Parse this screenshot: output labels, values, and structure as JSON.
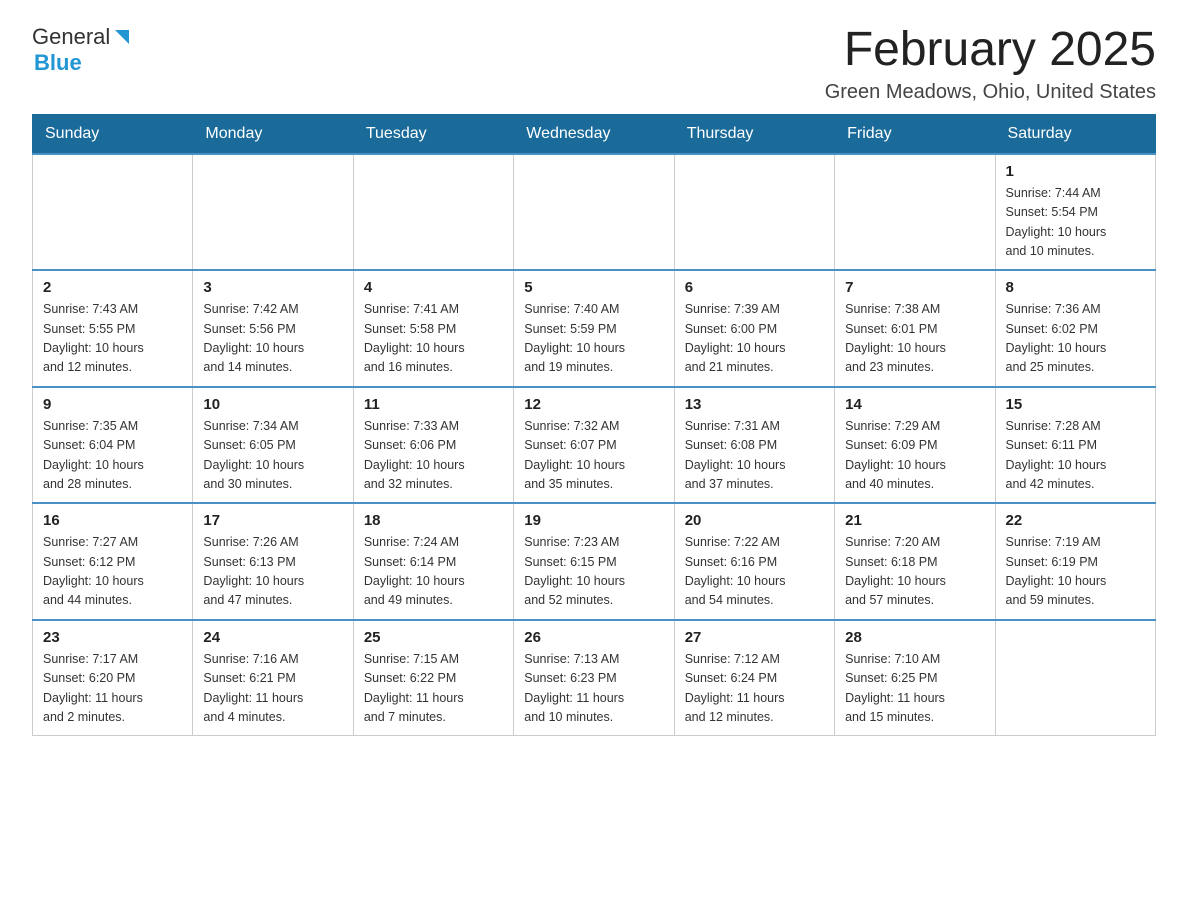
{
  "header": {
    "logo_general": "General",
    "logo_blue": "Blue",
    "title": "February 2025",
    "subtitle": "Green Meadows, Ohio, United States"
  },
  "days_of_week": [
    "Sunday",
    "Monday",
    "Tuesday",
    "Wednesday",
    "Thursday",
    "Friday",
    "Saturday"
  ],
  "weeks": [
    [
      {
        "day": "",
        "info": ""
      },
      {
        "day": "",
        "info": ""
      },
      {
        "day": "",
        "info": ""
      },
      {
        "day": "",
        "info": ""
      },
      {
        "day": "",
        "info": ""
      },
      {
        "day": "",
        "info": ""
      },
      {
        "day": "1",
        "info": "Sunrise: 7:44 AM\nSunset: 5:54 PM\nDaylight: 10 hours\nand 10 minutes."
      }
    ],
    [
      {
        "day": "2",
        "info": "Sunrise: 7:43 AM\nSunset: 5:55 PM\nDaylight: 10 hours\nand 12 minutes."
      },
      {
        "day": "3",
        "info": "Sunrise: 7:42 AM\nSunset: 5:56 PM\nDaylight: 10 hours\nand 14 minutes."
      },
      {
        "day": "4",
        "info": "Sunrise: 7:41 AM\nSunset: 5:58 PM\nDaylight: 10 hours\nand 16 minutes."
      },
      {
        "day": "5",
        "info": "Sunrise: 7:40 AM\nSunset: 5:59 PM\nDaylight: 10 hours\nand 19 minutes."
      },
      {
        "day": "6",
        "info": "Sunrise: 7:39 AM\nSunset: 6:00 PM\nDaylight: 10 hours\nand 21 minutes."
      },
      {
        "day": "7",
        "info": "Sunrise: 7:38 AM\nSunset: 6:01 PM\nDaylight: 10 hours\nand 23 minutes."
      },
      {
        "day": "8",
        "info": "Sunrise: 7:36 AM\nSunset: 6:02 PM\nDaylight: 10 hours\nand 25 minutes."
      }
    ],
    [
      {
        "day": "9",
        "info": "Sunrise: 7:35 AM\nSunset: 6:04 PM\nDaylight: 10 hours\nand 28 minutes."
      },
      {
        "day": "10",
        "info": "Sunrise: 7:34 AM\nSunset: 6:05 PM\nDaylight: 10 hours\nand 30 minutes."
      },
      {
        "day": "11",
        "info": "Sunrise: 7:33 AM\nSunset: 6:06 PM\nDaylight: 10 hours\nand 32 minutes."
      },
      {
        "day": "12",
        "info": "Sunrise: 7:32 AM\nSunset: 6:07 PM\nDaylight: 10 hours\nand 35 minutes."
      },
      {
        "day": "13",
        "info": "Sunrise: 7:31 AM\nSunset: 6:08 PM\nDaylight: 10 hours\nand 37 minutes."
      },
      {
        "day": "14",
        "info": "Sunrise: 7:29 AM\nSunset: 6:09 PM\nDaylight: 10 hours\nand 40 minutes."
      },
      {
        "day": "15",
        "info": "Sunrise: 7:28 AM\nSunset: 6:11 PM\nDaylight: 10 hours\nand 42 minutes."
      }
    ],
    [
      {
        "day": "16",
        "info": "Sunrise: 7:27 AM\nSunset: 6:12 PM\nDaylight: 10 hours\nand 44 minutes."
      },
      {
        "day": "17",
        "info": "Sunrise: 7:26 AM\nSunset: 6:13 PM\nDaylight: 10 hours\nand 47 minutes."
      },
      {
        "day": "18",
        "info": "Sunrise: 7:24 AM\nSunset: 6:14 PM\nDaylight: 10 hours\nand 49 minutes."
      },
      {
        "day": "19",
        "info": "Sunrise: 7:23 AM\nSunset: 6:15 PM\nDaylight: 10 hours\nand 52 minutes."
      },
      {
        "day": "20",
        "info": "Sunrise: 7:22 AM\nSunset: 6:16 PM\nDaylight: 10 hours\nand 54 minutes."
      },
      {
        "day": "21",
        "info": "Sunrise: 7:20 AM\nSunset: 6:18 PM\nDaylight: 10 hours\nand 57 minutes."
      },
      {
        "day": "22",
        "info": "Sunrise: 7:19 AM\nSunset: 6:19 PM\nDaylight: 10 hours\nand 59 minutes."
      }
    ],
    [
      {
        "day": "23",
        "info": "Sunrise: 7:17 AM\nSunset: 6:20 PM\nDaylight: 11 hours\nand 2 minutes."
      },
      {
        "day": "24",
        "info": "Sunrise: 7:16 AM\nSunset: 6:21 PM\nDaylight: 11 hours\nand 4 minutes."
      },
      {
        "day": "25",
        "info": "Sunrise: 7:15 AM\nSunset: 6:22 PM\nDaylight: 11 hours\nand 7 minutes."
      },
      {
        "day": "26",
        "info": "Sunrise: 7:13 AM\nSunset: 6:23 PM\nDaylight: 11 hours\nand 10 minutes."
      },
      {
        "day": "27",
        "info": "Sunrise: 7:12 AM\nSunset: 6:24 PM\nDaylight: 11 hours\nand 12 minutes."
      },
      {
        "day": "28",
        "info": "Sunrise: 7:10 AM\nSunset: 6:25 PM\nDaylight: 11 hours\nand 15 minutes."
      },
      {
        "day": "",
        "info": ""
      }
    ]
  ]
}
